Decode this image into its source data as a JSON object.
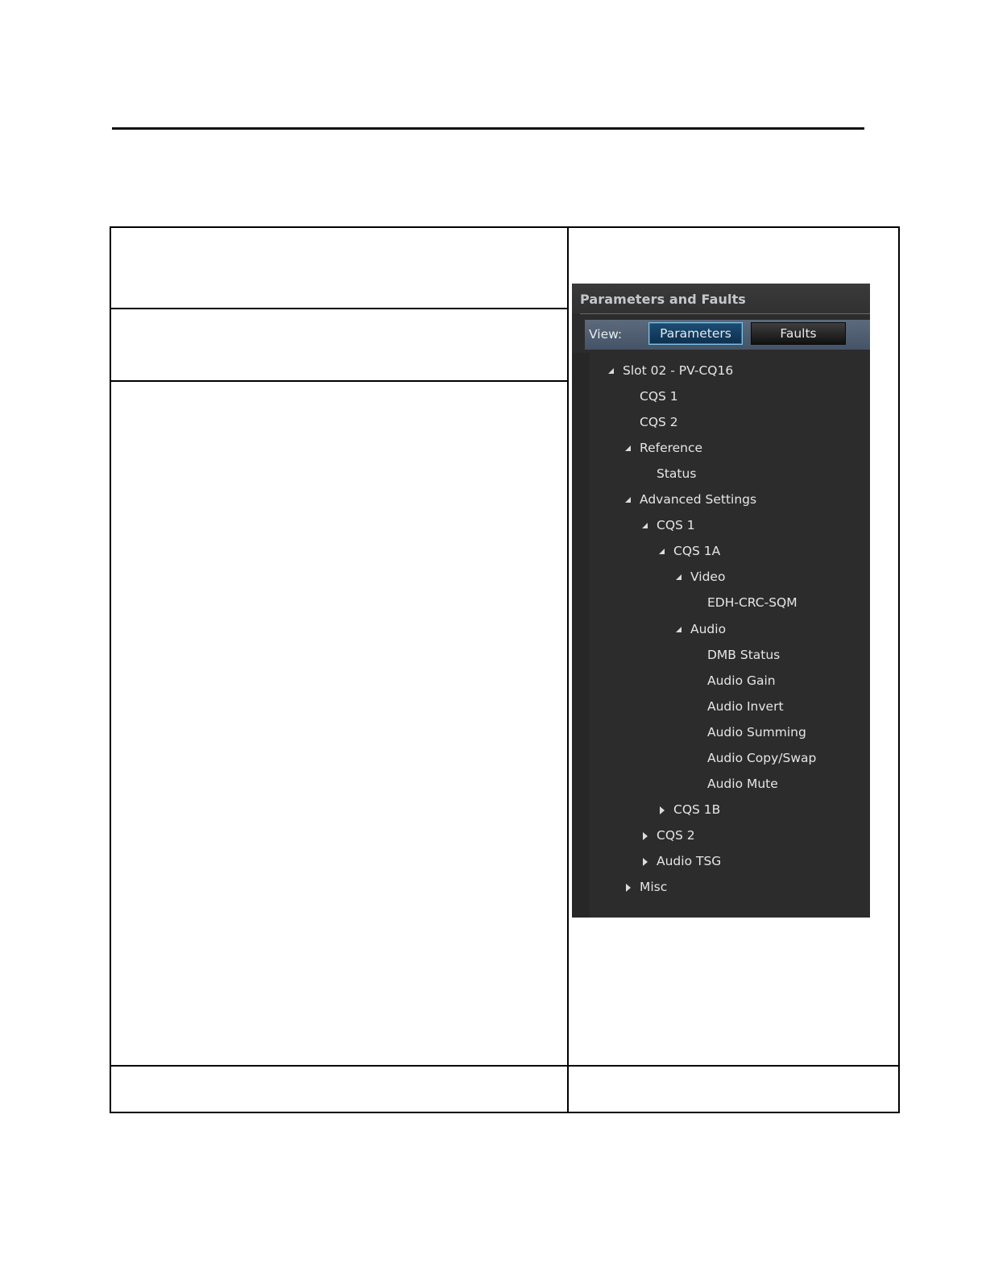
{
  "panel": {
    "title": "Parameters and Faults",
    "view_label": "View:",
    "buttons": {
      "parameters": "Parameters",
      "faults": "Faults"
    },
    "selected_view": "Parameters",
    "tree": [
      {
        "label": "Slot 02 - PV-CQ16",
        "level": 0,
        "state": "expanded"
      },
      {
        "label": "CQS 1",
        "level": 1,
        "state": "leaf"
      },
      {
        "label": "CQS 2",
        "level": 1,
        "state": "leaf"
      },
      {
        "label": "Reference",
        "level": 1,
        "state": "expanded"
      },
      {
        "label": "Status",
        "level": 2,
        "state": "leaf"
      },
      {
        "label": "Advanced Settings",
        "level": 1,
        "state": "expanded"
      },
      {
        "label": "CQS 1",
        "level": 2,
        "state": "expanded"
      },
      {
        "label": "CQS 1A",
        "level": 3,
        "state": "expanded"
      },
      {
        "label": "Video",
        "level": 4,
        "state": "expanded"
      },
      {
        "label": "EDH-CRC-SQM",
        "level": 5,
        "state": "leaf"
      },
      {
        "label": "Audio",
        "level": 4,
        "state": "expanded"
      },
      {
        "label": "DMB Status",
        "level": 5,
        "state": "leaf"
      },
      {
        "label": "Audio Gain",
        "level": 5,
        "state": "leaf"
      },
      {
        "label": "Audio Invert",
        "level": 5,
        "state": "leaf"
      },
      {
        "label": "Audio Summing",
        "level": 5,
        "state": "leaf"
      },
      {
        "label": "Audio Copy/Swap",
        "level": 5,
        "state": "leaf"
      },
      {
        "label": "Audio Mute",
        "level": 5,
        "state": "leaf"
      },
      {
        "label": "CQS 1B",
        "level": 3,
        "state": "collapsed"
      },
      {
        "label": "CQS 2",
        "level": 2,
        "state": "collapsed"
      },
      {
        "label": "Audio TSG",
        "level": 2,
        "state": "collapsed"
      },
      {
        "label": "Misc",
        "level": 1,
        "state": "collapsed"
      }
    ]
  }
}
